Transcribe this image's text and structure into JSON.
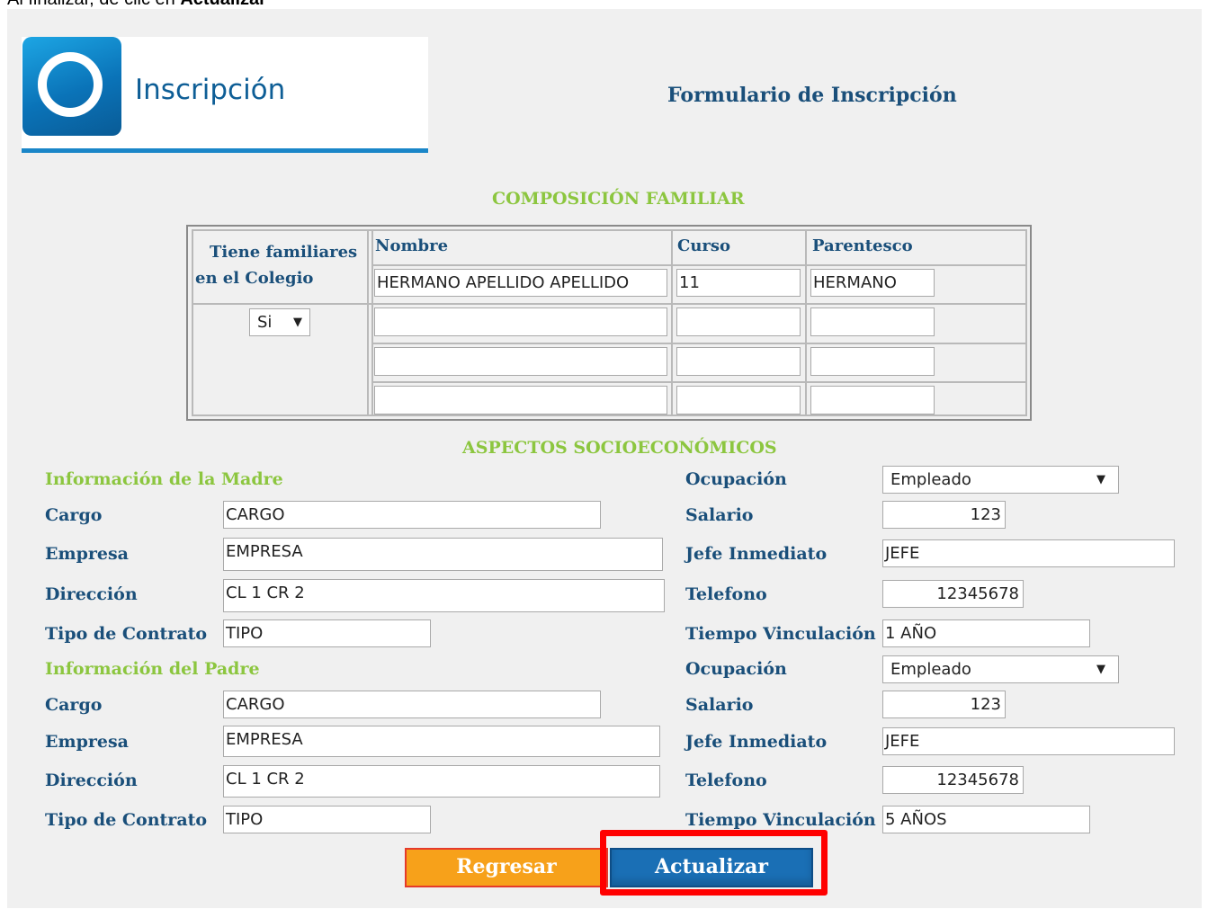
{
  "instruction": {
    "prefix": "Al finalizar, dé clic en ",
    "action": "Actualizar"
  },
  "header": {
    "app_title": "Inscripción",
    "form_title": "Formulario de Inscripción"
  },
  "family": {
    "section_title": "COMPOSICIÓN FAMILIAR",
    "question_line1": "Tiene familiares",
    "question_line2": "en el Colegio",
    "has_family_value": "Si",
    "columns": {
      "name": "Nombre",
      "course": "Curso",
      "relation": "Parentesco"
    },
    "rows": [
      {
        "name": "HERMANO APELLIDO APELLIDO",
        "course": "11",
        "relation": "HERMANO"
      },
      {
        "name": "",
        "course": "",
        "relation": ""
      },
      {
        "name": "",
        "course": "",
        "relation": ""
      },
      {
        "name": "",
        "course": "",
        "relation": ""
      }
    ]
  },
  "socio": {
    "section_title": "ASPECTOS SOCIOECONÓMICOS",
    "mother": {
      "title": "Información de la Madre",
      "cargo_label": "Cargo",
      "cargo": "CARGO",
      "empresa_label": "Empresa",
      "empresa": "EMPRESA",
      "direccion_label": "Dirección",
      "direccion": "CL 1 CR 2",
      "contrato_label": "Tipo de Contrato",
      "contrato": "TIPO",
      "ocupacion_label": "Ocupación",
      "ocupacion": "Empleado",
      "salario_label": "Salario",
      "salario": "123",
      "jefe_label": "Jefe Inmediato",
      "jefe": "JEFE",
      "telefono_label": "Telefono",
      "telefono": "12345678",
      "tiempo_label": "Tiempo Vinculación",
      "tiempo": "1 AÑO"
    },
    "father": {
      "title": "Información del Padre",
      "cargo_label": "Cargo",
      "cargo": "CARGO",
      "empresa_label": "Empresa",
      "empresa": "EMPRESA",
      "direccion_label": "Dirección",
      "direccion": "CL 1 CR 2",
      "contrato_label": "Tipo de Contrato",
      "contrato": "TIPO",
      "ocupacion_label": "Ocupación",
      "ocupacion": "Empleado",
      "salario_label": "Salario",
      "salario": "123",
      "jefe_label": "Jefe Inmediato",
      "jefe": "JEFE",
      "telefono_label": "Telefono",
      "telefono": "12345678",
      "tiempo_label": "Tiempo Vinculación",
      "tiempo": "5 AÑOS"
    }
  },
  "buttons": {
    "back": "Regresar",
    "update": "Actualizar"
  },
  "colors": {
    "accent_blue": "#1a6fb5",
    "accent_orange": "#f7a11a",
    "accent_green": "#8cc63f",
    "highlight_red": "#ff0000"
  }
}
